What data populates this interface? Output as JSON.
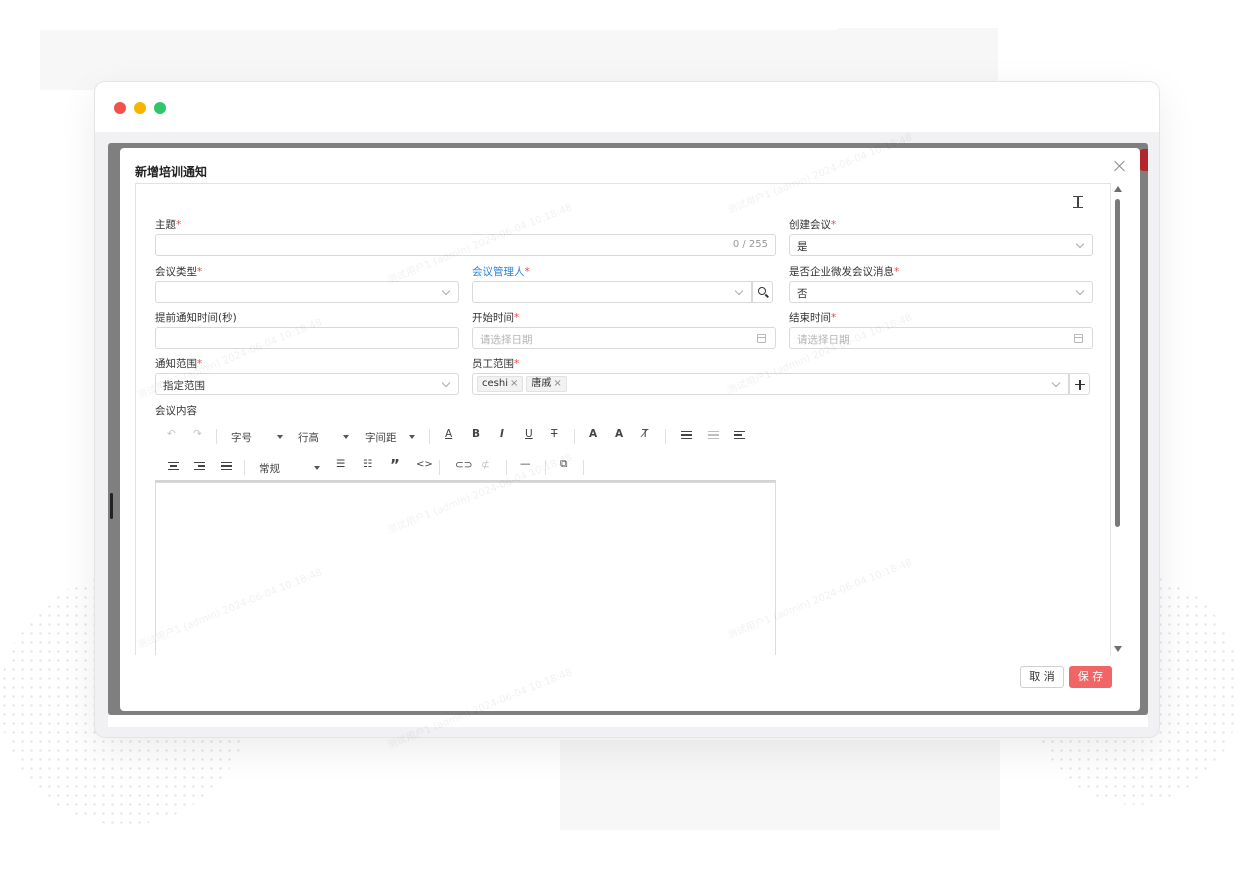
{
  "modal": {
    "title": "新增培训通知",
    "close_icon": "close-icon",
    "fullscreen_icon": "fullscreen-icon"
  },
  "form": {
    "subject": {
      "label": "主题",
      "value": "",
      "counter": "0 / 255"
    },
    "create_meeting": {
      "label": "创建会议",
      "value": "是"
    },
    "meeting_type": {
      "label": "会议类型",
      "value": ""
    },
    "meeting_manager": {
      "label": "会议管理人",
      "value": ""
    },
    "wecom_message": {
      "label": "是否企业微发会议消息",
      "value": "否"
    },
    "advance_notice": {
      "label": "提前通知时间(秒)",
      "value": ""
    },
    "start_time": {
      "label": "开始时间",
      "placeholder": "请选择日期"
    },
    "end_time": {
      "label": "结束时间",
      "placeholder": "请选择日期"
    },
    "notice_scope": {
      "label": "通知范围",
      "value": "指定范围"
    },
    "staff_scope": {
      "label": "员工范围",
      "tags": [
        "ceshi",
        "唐戚"
      ]
    },
    "content": {
      "label": "会议内容"
    },
    "required_mark": "*"
  },
  "editor": {
    "font_size": "字号",
    "line_height": "行高",
    "letter_spacing": "字间距",
    "paragraph": "常规",
    "bold": "B",
    "italic": "I",
    "underline": "U",
    "strike": "T",
    "font_color": "A",
    "font_up": "A",
    "font_down": "A",
    "quote": "”",
    "code": "<>"
  },
  "footer": {
    "cancel": "取 消",
    "save": "保 存"
  },
  "watermark": "测试用户1 (admin) 2024-06-04 10:18:48",
  "colors": {
    "accent": "#f06666",
    "link_blue": "#2a86d8",
    "required": "#e34d4d",
    "mac_red": "#f3524a",
    "mac_yellow": "#f7b500",
    "mac_green": "#2fc76a"
  }
}
